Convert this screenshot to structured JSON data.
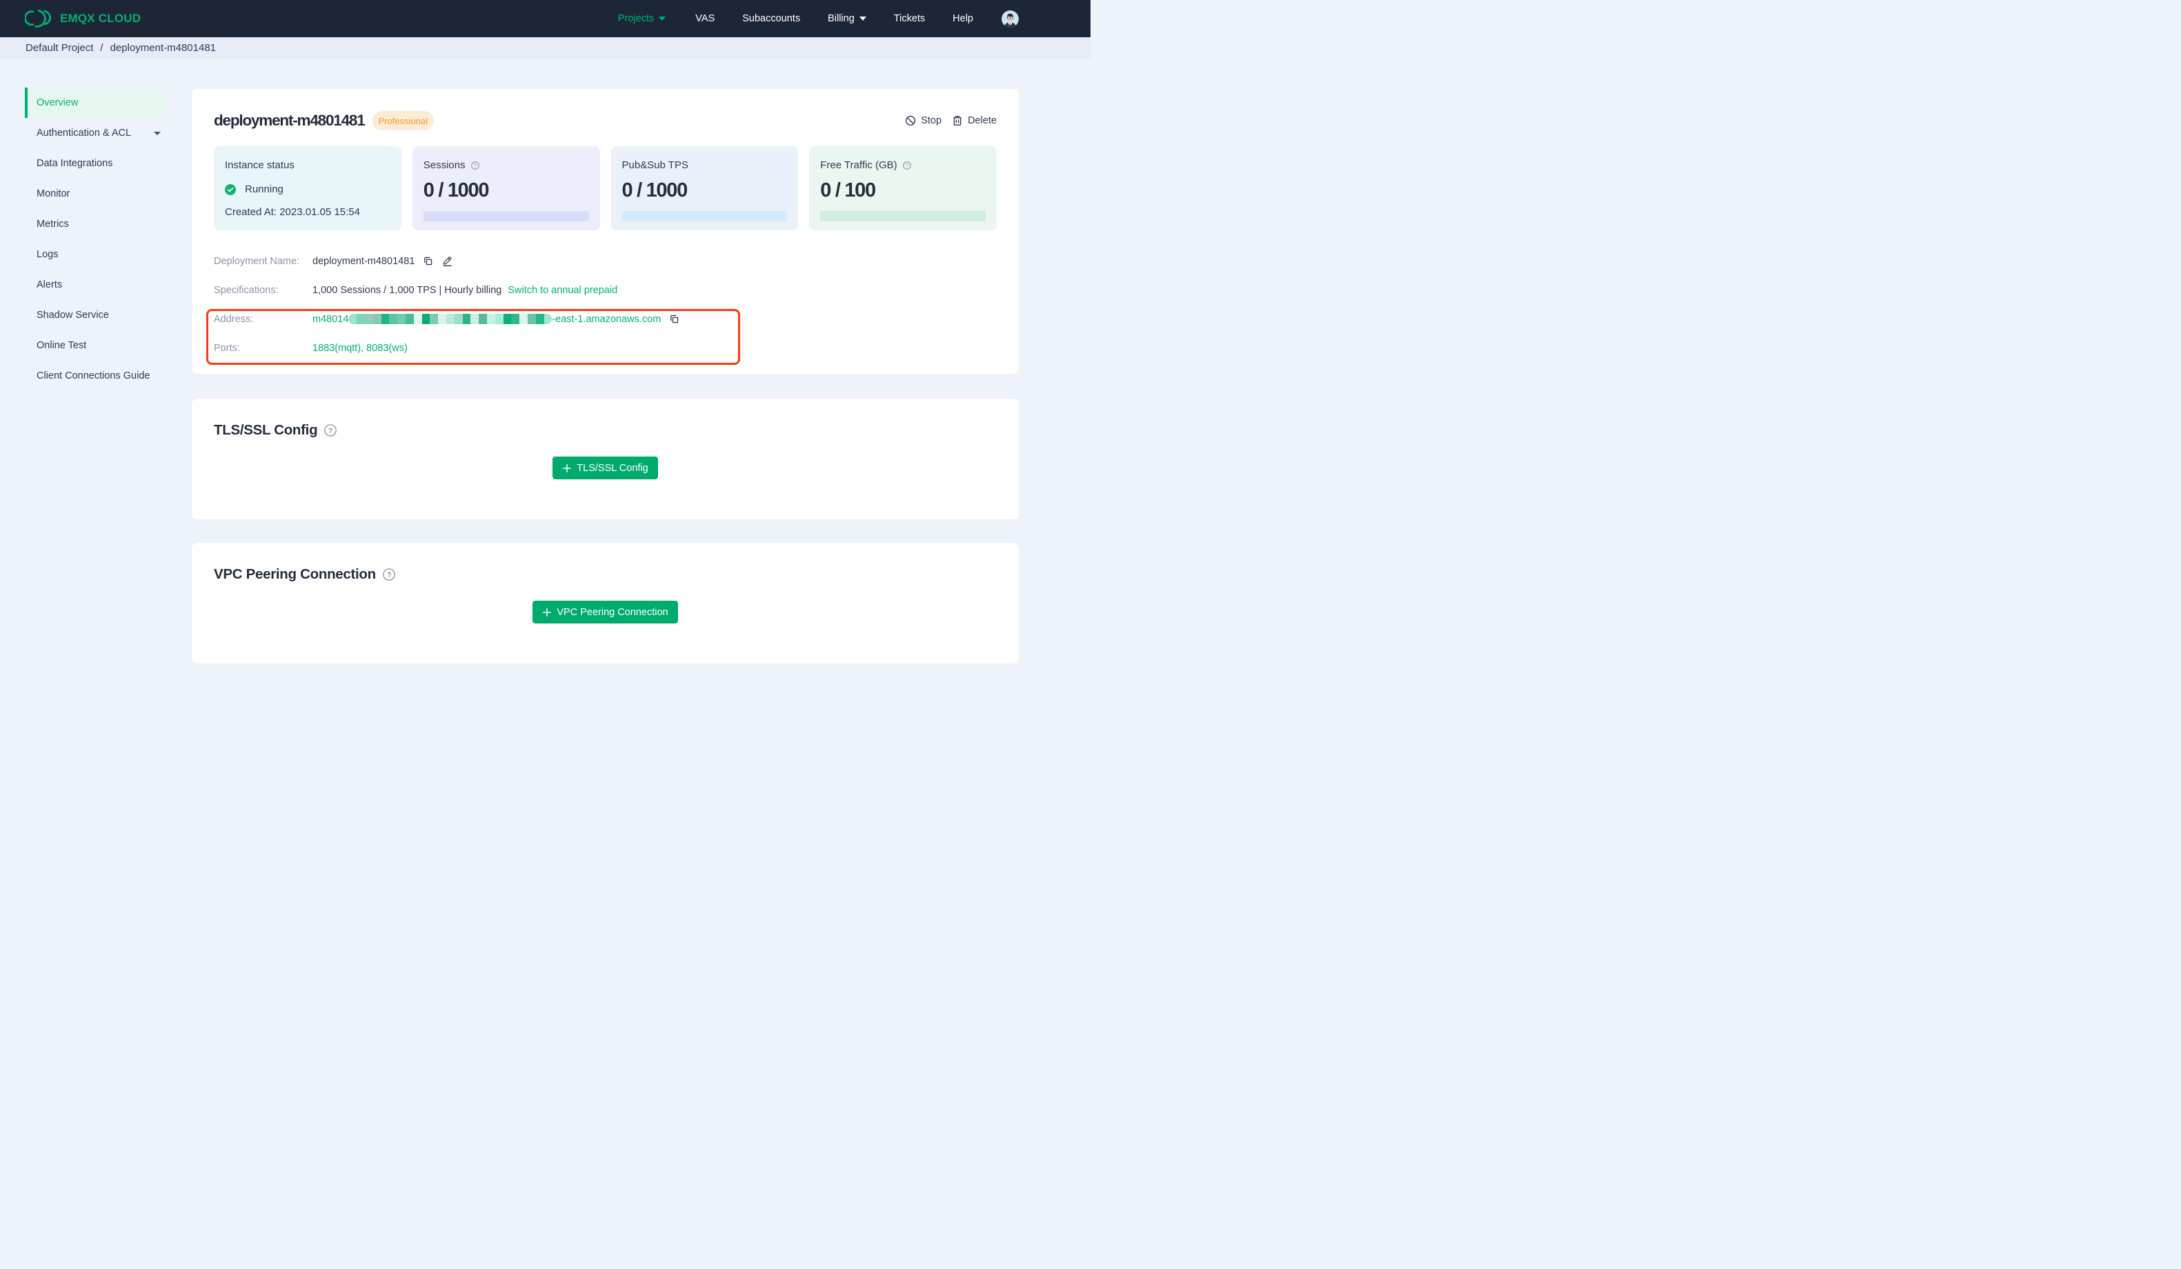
{
  "colors": {
    "brand-green": "#00B173",
    "button-green": "#00AB6E",
    "navbar-bg": "#1D2636",
    "breadcrumb-bg": "#E7ECF8",
    "page-bg": "#EDF2FB",
    "card-bg": "#FFFFFF",
    "title-dark": "#242D3C",
    "text-dark": "#303A50",
    "label-gray": "#8A92A5",
    "badge-bg": "#FCEBD5",
    "badge-text": "#F59B25",
    "stat-cyan-bg": "#E8F6FA",
    "stat-lavender-bg": "#ECEEFB",
    "stat-blue-bg": "#EBF1FB",
    "stat-green-bg": "#E9F7F0",
    "bar-lavender": "#D9DDF8",
    "bar-blue": "#D6E9F8",
    "bar-green": "#D3EDDF",
    "annotation-red": "#F83B13",
    "icon-gray": "#8E959E",
    "running-green": "#13B26D",
    "sidebar-active-bg": "#E7F6EE"
  },
  "navbar": {
    "brand": "EMQX CLOUD",
    "items": [
      {
        "label": "Projects",
        "active": true,
        "caret": true
      },
      {
        "label": "VAS"
      },
      {
        "label": "Subaccounts"
      },
      {
        "label": "Billing",
        "caret": true
      },
      {
        "label": "Tickets"
      },
      {
        "label": "Help"
      }
    ]
  },
  "breadcrumb": {
    "project": "Default Project",
    "separator": "/",
    "current": "deployment-m4801481"
  },
  "sidebar": {
    "items": [
      {
        "label": "Overview",
        "active": true
      },
      {
        "label": "Authentication & ACL",
        "caret": true
      },
      {
        "label": "Data Integrations"
      },
      {
        "label": "Monitor"
      },
      {
        "label": "Metrics"
      },
      {
        "label": "Logs"
      },
      {
        "label": "Alerts"
      },
      {
        "label": "Shadow Service"
      },
      {
        "label": "Online Test"
      },
      {
        "label": "Client Connections Guide"
      }
    ]
  },
  "deployment": {
    "title": "deployment-m4801481",
    "badge": "Professional",
    "stop_label": "Stop",
    "delete_label": "Delete",
    "stats": {
      "instance": {
        "title": "Instance status",
        "status": "Running",
        "created": "Created At: 2023.01.05 15:54"
      },
      "sessions": {
        "title": "Sessions",
        "value": "0 / 1000"
      },
      "tps": {
        "title": "Pub&Sub TPS",
        "value": "0 / 1000"
      },
      "traffic": {
        "title": "Free Traffic (GB)",
        "value": "0 / 100"
      }
    },
    "details": {
      "name": {
        "label": "Deployment Name:",
        "value": "deployment-m4801481"
      },
      "specs": {
        "label": "Specifications:",
        "value": "1,000 Sessions / 1,000 TPS | Hourly billing",
        "link": "Switch to annual prepaid"
      },
      "address": {
        "label": "Address:",
        "prefix": "m48014",
        "suffix": "-east-1.amazonaws.com",
        "mosaic": [
          "#9fe3c8",
          "#7fd4b9",
          "#93cdbb",
          "#8cc7b4",
          "#1db586",
          "#5fc4a6",
          "#72cab1",
          "#46bd97",
          "#e0f7ee",
          "#0ea977",
          "#7acbb4",
          "#d8f3e8",
          "#bce8d6",
          "#9eddc8",
          "#28b789",
          "#cdefdf",
          "#59b99c",
          "#c6f2e0",
          "#a8ecd5",
          "#0fb07e",
          "#2fba8c",
          "#ddf6ec",
          "#6cc3a8",
          "#25b689",
          "#9fe8cf"
        ]
      },
      "ports": {
        "label": "Ports:",
        "value": "1883(mqtt), 8083(ws)"
      }
    }
  },
  "tls_section": {
    "title": "TLS/SSL Config",
    "button_label": "TLS/SSL Config"
  },
  "vpc_section": {
    "title": "VPC Peering Connection",
    "button_label": "VPC Peering Connection"
  }
}
